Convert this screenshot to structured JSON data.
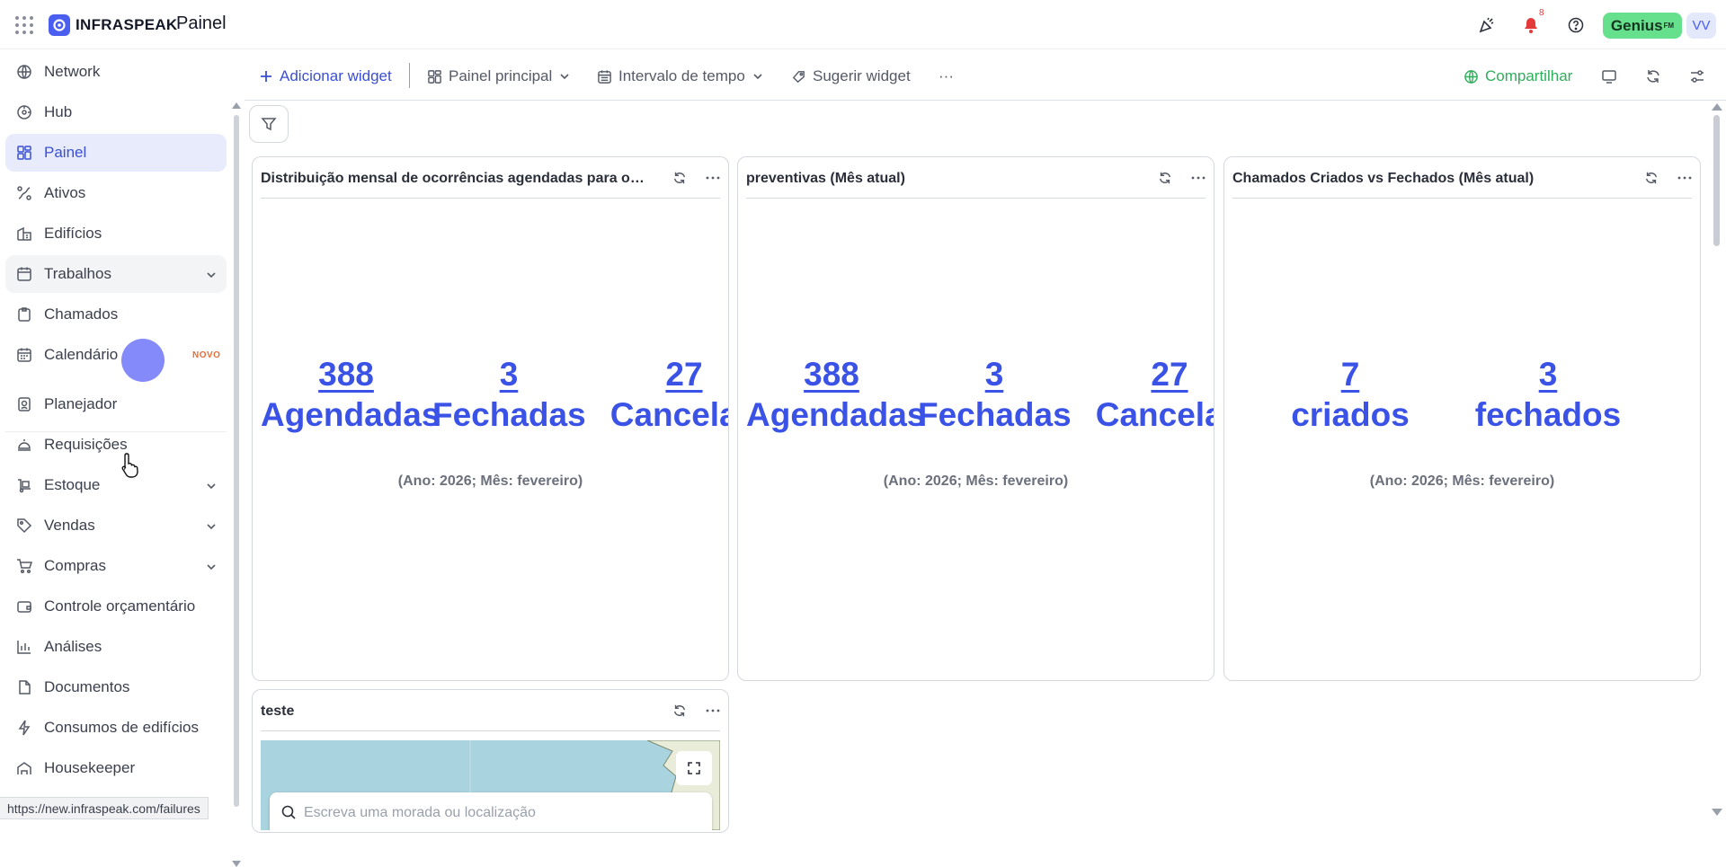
{
  "header": {
    "logo_text": "INFRASPEAK",
    "title": "Painel",
    "notification_count": "8",
    "genius_label": "Genius",
    "genius_sup": "FM",
    "avatar_initials": "VV"
  },
  "sidebar": {
    "items": [
      {
        "label": "Network",
        "icon": "globe-icon"
      },
      {
        "label": "Hub",
        "icon": "hub-icon"
      },
      {
        "label": "Painel",
        "icon": "dashboard-icon",
        "active": true
      },
      {
        "label": "Ativos",
        "icon": "assets-icon"
      },
      {
        "label": "Edifícios",
        "icon": "building-icon"
      },
      {
        "label": "Trabalhos",
        "icon": "calendar-check-icon",
        "expandable": true
      },
      {
        "label": "Chamados",
        "icon": "clipboard-icon"
      },
      {
        "label": "Calendário",
        "icon": "calendar-icon",
        "badge": "NOVO"
      },
      {
        "label": "Planejador",
        "icon": "planner-icon"
      },
      {
        "label": "Requisições",
        "icon": "bell-service-icon"
      },
      {
        "label": "Estoque",
        "icon": "stock-icon",
        "expandable": true
      },
      {
        "label": "Vendas",
        "icon": "tag-icon",
        "expandable": true
      },
      {
        "label": "Compras",
        "icon": "cart-icon",
        "expandable": true
      },
      {
        "label": "Controle orçamentário",
        "icon": "wallet-icon"
      },
      {
        "label": "Análises",
        "icon": "bar-chart-icon"
      },
      {
        "label": "Documentos",
        "icon": "document-icon"
      },
      {
        "label": "Consumos de edifícios",
        "icon": "bolt-icon"
      },
      {
        "label": "Housekeeper",
        "icon": "housekeeper-icon"
      }
    ]
  },
  "status_url": "https://new.infraspeak.com/failures",
  "toolbar": {
    "add_widget": "Adicionar widget",
    "main_panel": "Painel principal",
    "time_interval": "Intervalo de tempo",
    "suggest_widget": "Sugerir widget",
    "more": "···",
    "share": "Compartilhar"
  },
  "widgets": {
    "w1": {
      "title": "Distribuição mensal de ocorrências agendadas para o i...",
      "kpis": [
        {
          "value": "388",
          "label": "Agendadas"
        },
        {
          "value": "3",
          "label": "Fechadas"
        },
        {
          "value": "27",
          "label": "Cancelad"
        }
      ],
      "subtitle": "(Ano: 2026; Mês: fevereiro)"
    },
    "w2": {
      "title": "preventivas (Mês atual)",
      "kpis": [
        {
          "value": "388",
          "label": "Agendadas"
        },
        {
          "value": "3",
          "label": "Fechadas"
        },
        {
          "value": "27",
          "label": "Cancelad"
        }
      ],
      "subtitle": "(Ano: 2026; Mês: fevereiro)"
    },
    "w3": {
      "title": "Chamados Criados vs Fechados (Mês atual)",
      "kpis": [
        {
          "value": "7",
          "label": "criados"
        },
        {
          "value": "3",
          "label": "fechados"
        }
      ],
      "subtitle": "(Ano: 2026; Mês: fevereiro)"
    },
    "w4": {
      "title": "teste",
      "map_search_placeholder": "Escreva uma morada ou localização"
    }
  },
  "colors": {
    "accent": "#3a52e6",
    "active_bg": "#e7ebfb",
    "genius": "#66e08d",
    "share": "#2fae5b",
    "bell": "#e53a3a"
  }
}
